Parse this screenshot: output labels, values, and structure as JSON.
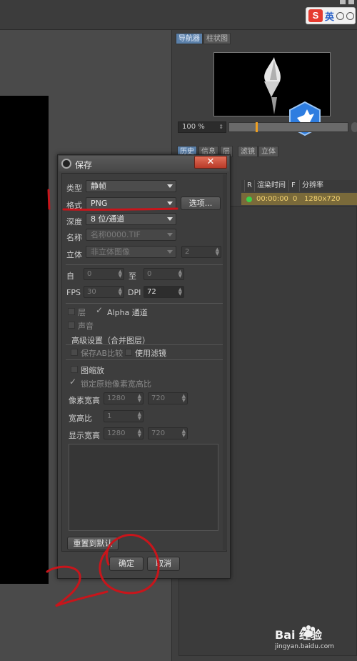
{
  "ime": {
    "logo": "S",
    "lang": "英"
  },
  "right_panel": {
    "tabs_top": [
      "导航器",
      "柱状图"
    ],
    "zoom": "100 %",
    "tabs_mid": [
      "历史",
      "信息",
      "层",
      "滤镜",
      "立体"
    ],
    "history_headers": [
      "R",
      "渲染时间",
      "F",
      "分辨率"
    ],
    "history_row": {
      "time": "00:00:00",
      "f": "0",
      "res": "1280x720"
    }
  },
  "dialog": {
    "title": "保存",
    "close": "✕",
    "type_label": "类型",
    "type_value": "静帧",
    "format_label": "格式",
    "format_value": "PNG",
    "options_button": "选项...",
    "depth_label": "深度",
    "depth_value": "8 位/通道",
    "name_label": "名称",
    "name_value": "名称0000.TIF",
    "stereo_label": "立体",
    "stereo_value": "非立体图像",
    "stereo_num": "2",
    "from_label": "自",
    "from_value": "0",
    "to_label": "至",
    "to_value": "0",
    "fps_label": "FPS",
    "fps_value": "30",
    "dpi_label": "DPI",
    "dpi_value": "72",
    "layer_label": "层",
    "alpha_label": "Alpha 通道",
    "sound_label": "声音",
    "advanced_title": "高级设置（合并图层）",
    "save_ab_label": "保存AB比较",
    "filter_label": "使用滤镜",
    "scale_label": "图缩放",
    "lock_ratio_label": "锁定原始像素宽高比",
    "pixel_size_label": "像素宽高",
    "pixel_w": "1280",
    "pixel_h": "720",
    "ratio_label": "宽高比",
    "ratio_value": "1",
    "display_size_label": "显示宽高",
    "display_w": "1280",
    "display_h": "720",
    "reset_button": "重置到默认",
    "ok_button": "确定",
    "cancel_button": "取消"
  },
  "watermark": {
    "text": "Bai 经验",
    "url": "jingyan.baidu.com"
  }
}
